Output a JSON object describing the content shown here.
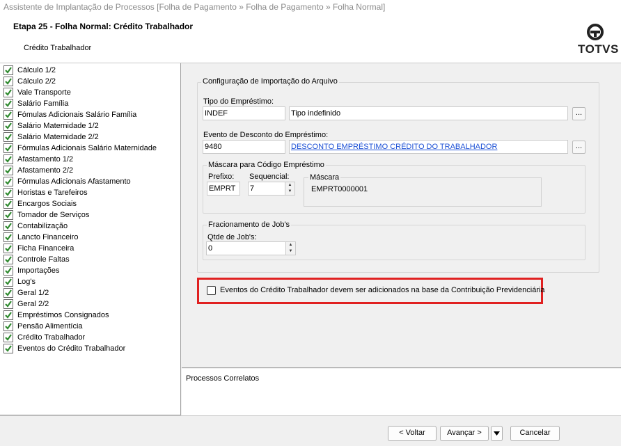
{
  "window": {
    "title": "Assistente de Implantação de Processos [Folha de Pagamento » Folha de Pagamento » Folha Normal]"
  },
  "header": {
    "step_title": "Etapa 25 - Folha Normal: Crédito Trabalhador",
    "step_subtitle": "Crédito Trabalhador",
    "logo_text": "TOTVS"
  },
  "steps": [
    "Cálculo 1/2",
    "Cálculo 2/2",
    "Vale Transporte",
    "Salário Família",
    "Fómulas Adicionais Salário Família",
    "Salário Maternidade 1/2",
    "Salário Maternidade 2/2",
    "Fórmulas Adicionais Salário Maternidade",
    "Afastamento 1/2",
    "Afastamento 2/2",
    "Fórmulas Adicionais Afastamento",
    "Horistas e Tarefeiros",
    "Encargos Sociais",
    "Tomador de Serviços",
    "Contabilização",
    "Lancto Financeiro",
    "Ficha Financeira",
    "Controle Faltas",
    "Importações",
    "Log's",
    "Geral 1/2",
    "Geral 2/2",
    "Empréstimos Consignados",
    "Pensão Alimentícia",
    "Crédito Trabalhador",
    "Eventos do Crédito Trabalhador"
  ],
  "config": {
    "group_label": "Configuração de Importação do Arquivo",
    "tipo_label": "Tipo do Empréstimo:",
    "tipo_code": "INDEF",
    "tipo_desc": "Tipo indefinido",
    "evento_label": "Evento de Desconto do Empréstimo:",
    "evento_code": "9480",
    "evento_desc": "DESCONTO EMPRÉSTIMO CRÉDITO DO TRABALHADOR",
    "lookup_label": "..."
  },
  "mascara": {
    "group_label": "Máscara para Código Empréstimo",
    "prefixo_label": "Prefixo:",
    "prefixo_value": "EMPRT",
    "sequencial_label": "Sequencial:",
    "sequencial_value": "7",
    "mascara_label": "Máscara",
    "mascara_value": "EMPRT0000001"
  },
  "fracionamento": {
    "group_label": "Fracionamento de Job's",
    "qtde_label": "Qtde de Job's:",
    "qtde_value": "0"
  },
  "checkbox": {
    "label": "Eventos do Crédito Trabalhador devem ser adicionados na base da Contribuição Previdenciária",
    "checked": false
  },
  "correlatos": {
    "title": "Processos Correlatos"
  },
  "footer": {
    "back": "< Voltar",
    "next": "Avançar >",
    "cancel": "Cancelar"
  },
  "colors": {
    "highlight": "#e02020",
    "link": "#1a4fd6",
    "check_green": "#2f8a2f"
  }
}
